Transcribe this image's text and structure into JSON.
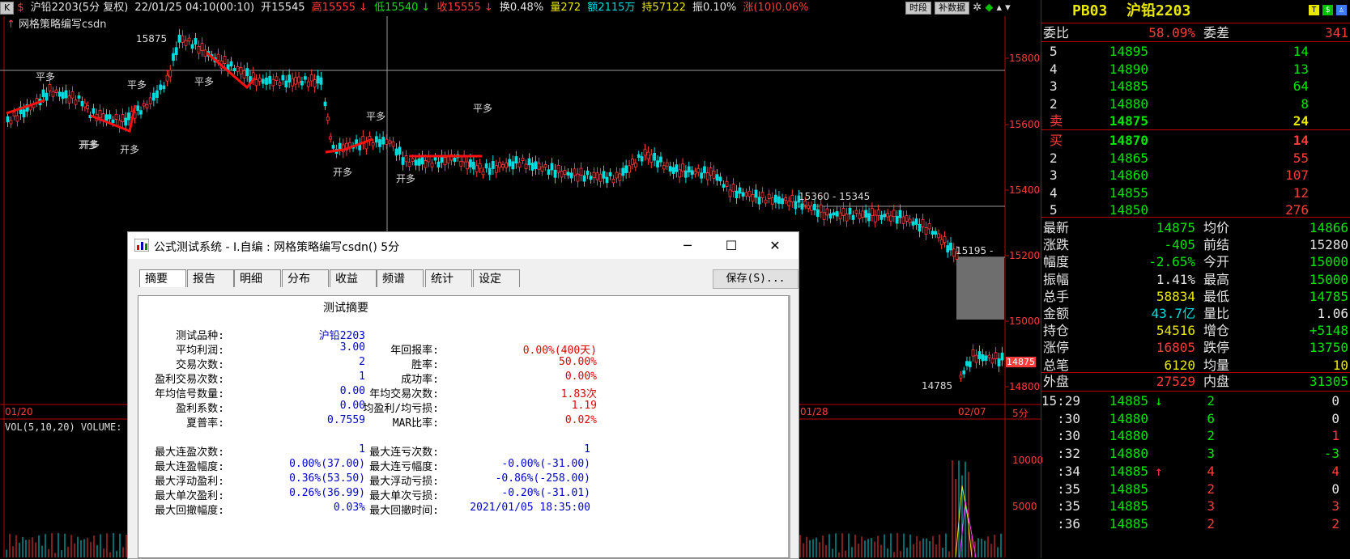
{
  "header": {
    "icon_k": "K",
    "icon_s": "$",
    "symbol": "沪铅2203(5分 复权)",
    "datetime": "22/01/25 04:10(00:10)",
    "open": "开15545",
    "high": "高15555",
    "low": "低15540",
    "close": "收15555",
    "turnover": "换0.48%",
    "volume": "量272",
    "amount": "额2115万",
    "holding": "持57122",
    "amplitude": "振0.10%",
    "change": "涨(10)0.06%",
    "btn_period": "时段",
    "btn_data": "补数据",
    "formula": "网格策略编写csdn",
    "colors": {
      "red": "#ff3c3c",
      "green": "#00e600",
      "cyan": "#00dcdc",
      "yellow": "#e8e800"
    }
  },
  "chart": {
    "price_ticks": [
      "15800",
      "15600",
      "15400",
      "15200",
      "15000",
      "14800"
    ],
    "current_price": "14875",
    "range_label": "15360 - 15345",
    "range_label2": "15195 -",
    "low_label": "14785",
    "high_label": "15875",
    "date_labels": [
      "01/20",
      "01/28",
      "02/07"
    ],
    "period": "5分",
    "vol_label": "VOL(5,10,20) VOLUME:",
    "vol_ticks": [
      "10000",
      "5000"
    ],
    "signals": [
      "平多",
      "开多",
      "平多",
      "开多",
      "平多",
      "开多",
      "平多",
      "开多",
      "开多",
      "平多"
    ]
  },
  "quote": {
    "code": "PB03",
    "name": "沪铅2203",
    "wb_label": "委比",
    "wb_value": "58.09%",
    "wc_label": "委差",
    "wc_value": "341",
    "asks": [
      {
        "lvl": "5",
        "price": "14895",
        "vol": "14"
      },
      {
        "lvl": "4",
        "price": "14890",
        "vol": "13"
      },
      {
        "lvl": "3",
        "price": "14885",
        "vol": "64"
      },
      {
        "lvl": "2",
        "price": "14880",
        "vol": "8"
      },
      {
        "lvl": "卖",
        "price": "14875",
        "vol": "24"
      }
    ],
    "bids": [
      {
        "lvl": "买",
        "price": "14870",
        "vol": "14"
      },
      {
        "lvl": "2",
        "price": "14865",
        "vol": "55"
      },
      {
        "lvl": "3",
        "price": "14860",
        "vol": "107"
      },
      {
        "lvl": "4",
        "price": "14855",
        "vol": "12"
      },
      {
        "lvl": "5",
        "price": "14850",
        "vol": "276"
      }
    ],
    "stats": [
      {
        "l1": "最新",
        "v1": "14875",
        "l2": "均价",
        "v2": "14866"
      },
      {
        "l1": "涨跌",
        "v1": "-405",
        "l2": "前结",
        "v2": "15280"
      },
      {
        "l1": "幅度",
        "v1": "-2.65%",
        "l2": "今开",
        "v2": "15000"
      },
      {
        "l1": "振幅",
        "v1": "1.41%",
        "l2": "最高",
        "v2": "15000"
      },
      {
        "l1": "总手",
        "v1": "58834",
        "l2": "最低",
        "v2": "14785"
      },
      {
        "l1": "金额",
        "v1": "43.7亿",
        "l2": "量比",
        "v2": "1.06"
      },
      {
        "l1": "持仓",
        "v1": "54516",
        "l2": "增仓",
        "v2": "+5148"
      },
      {
        "l1": "涨停",
        "v1": "16805",
        "l2": "跌停",
        "v2": "13750"
      },
      {
        "l1": "总笔",
        "v1": "6120",
        "l2": "均量",
        "v2": "10"
      }
    ],
    "outer_label": "外盘",
    "outer_value": "27529",
    "inner_label": "内盘",
    "inner_value": "31305",
    "ticks": [
      {
        "t": "15:29",
        "p": "14885",
        "a": "↓",
        "v": "2",
        "d": "0"
      },
      {
        "t": ":30",
        "p": "14880",
        "a": "",
        "v": "6",
        "d": "0"
      },
      {
        "t": ":30",
        "p": "14880",
        "a": "",
        "v": "2",
        "d": "1"
      },
      {
        "t": ":32",
        "p": "14880",
        "a": "",
        "v": "3",
        "d": "-3"
      },
      {
        "t": ":34",
        "p": "14885",
        "a": "↑",
        "v": "4",
        "d": "4"
      },
      {
        "t": ":35",
        "p": "14885",
        "a": "",
        "v": "2",
        "d": "0"
      },
      {
        "t": ":35",
        "p": "14885",
        "a": "",
        "v": "3",
        "d": "3"
      },
      {
        "t": ":36",
        "p": "14885",
        "a": "",
        "v": "2",
        "d": "2"
      }
    ]
  },
  "dialog": {
    "title": "公式测试系统 - I.自编 : 网格策略编写csdn() 5分",
    "min": "─",
    "max": "☐",
    "close": "✕",
    "tabs": [
      "摘要",
      "报告",
      "明细",
      "分布",
      "收益",
      "频谱",
      "统计",
      "设定"
    ],
    "save": "保存(S)...",
    "heading": "测试摘要",
    "rows1": [
      {
        "label": "测试品种:",
        "value": "沪铅2203"
      },
      {
        "label": "平均利润:",
        "value": "3.00"
      },
      {
        "label": "交易次数:",
        "value": "2"
      },
      {
        "label": "盈利交易次数:",
        "value": "1"
      },
      {
        "label": "年均信号数量:",
        "value": "0.00"
      },
      {
        "label": "盈利系数:",
        "value": "0.00"
      },
      {
        "label": "夏普率:",
        "value": "0.7559"
      }
    ],
    "rows2": [
      {
        "label": "年回报率:",
        "value": "0.00%(400天)"
      },
      {
        "label": "胜率:",
        "value": "50.00%"
      },
      {
        "label": "成功率:",
        "value": "0.00%"
      },
      {
        "label": "年均交易次数:",
        "value": "1.83次"
      },
      {
        "label": "均盈利/均亏损:",
        "value": "1.19"
      },
      {
        "label": "MAR比率:",
        "value": "0.02%"
      }
    ],
    "rows3": [
      {
        "label": "最大连盈次数:",
        "value": "1"
      },
      {
        "label": "最大连盈幅度:",
        "value": "0.00%(37.00)"
      },
      {
        "label": "最大浮动盈利:",
        "value": "0.36%(53.50)"
      },
      {
        "label": "最大单次盈利:",
        "value": "0.26%(36.99)"
      },
      {
        "label": "最大回撤幅度:",
        "value": "0.03%"
      }
    ],
    "rows4": [
      {
        "label": "最大连亏次数:",
        "value": "1"
      },
      {
        "label": "最大连亏幅度:",
        "value": "-0.00%(-31.00)"
      },
      {
        "label": "最大浮动亏损:",
        "value": "-0.86%(-258.00)"
      },
      {
        "label": "最大单次亏损:",
        "value": "-0.20%(-31.01)"
      },
      {
        "label": "最大回撤时间:",
        "value": "2021/01/05 18:35:00"
      }
    ]
  }
}
